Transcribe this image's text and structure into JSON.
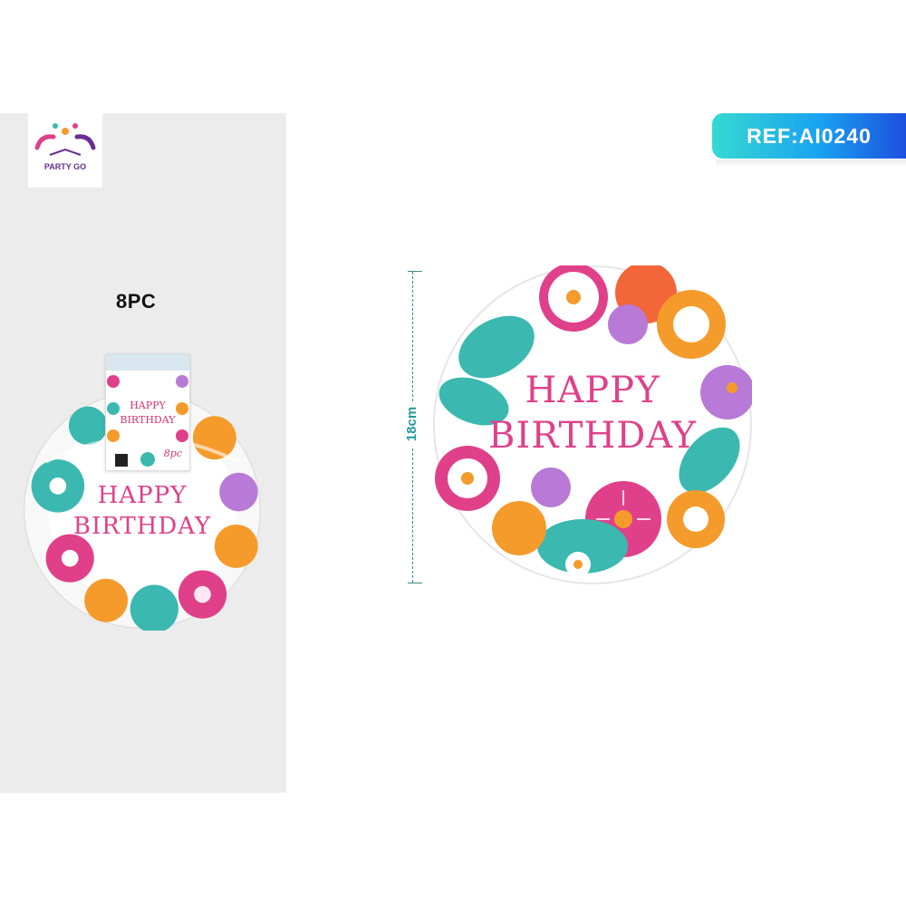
{
  "brand": {
    "logo_text": "PARTY GO"
  },
  "pack": {
    "count_label": "8PC"
  },
  "reference": {
    "label": "REF:AI0240"
  },
  "dimension": {
    "label": "18cm"
  },
  "plate": {
    "line1": "HAPPY",
    "line2": "BIRTHDAY"
  },
  "tag": {
    "line1": "HAPPY",
    "line2": "BIRTHDAY",
    "count": "8pc"
  },
  "colors": {
    "teal": "#3bb8b0",
    "pink": "#e0408a",
    "orange": "#f59b2c",
    "purple": "#b87ad6",
    "banner_start": "#36d9d2",
    "banner_end": "#1d4fe0"
  }
}
